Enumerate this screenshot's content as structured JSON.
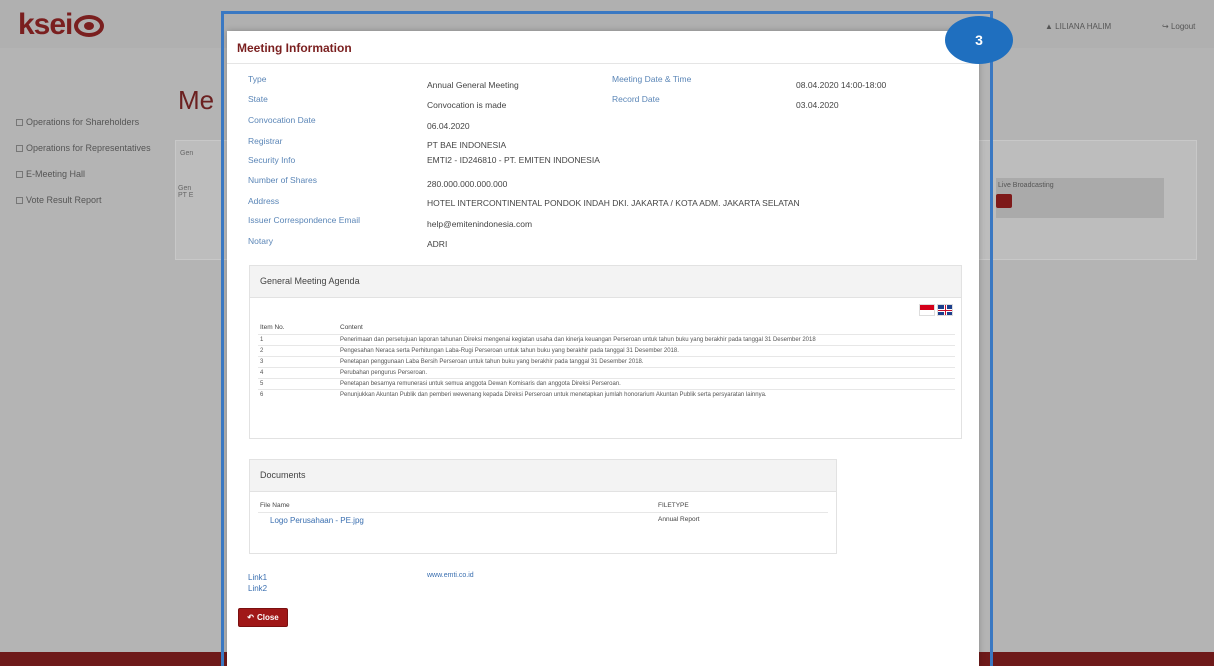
{
  "header": {
    "logo_text": "ksei",
    "logo_sub": "",
    "user_name": "LILIANA HALIM",
    "logout_label": "Logout"
  },
  "background": {
    "page_title": "Me",
    "tab_label": "Gen",
    "gen_label": "Gen",
    "gen_sub": "PT E",
    "live_label": "Live Broadcasting"
  },
  "sidebar": {
    "items": [
      {
        "label": "Operations for Shareholders"
      },
      {
        "label": "Operations for Representatives"
      },
      {
        "label": "E-Meeting Hall"
      },
      {
        "label": "Vote Result Report"
      }
    ]
  },
  "step_badge": "3",
  "modal": {
    "title": "Meeting Information",
    "fields": {
      "type_label": "Type",
      "type_value": "Annual General Meeting",
      "state_label": "State",
      "state_value": "Convocation is made",
      "convocation_label": "Convocation Date",
      "convocation_value": "06.04.2020",
      "registrar_label": "Registrar",
      "registrar_value": "PT BAE INDONESIA",
      "security_label": "Security Info",
      "security_value": "EMTI2 - ID246810 - PT. EMITEN INDONESIA",
      "shares_label": "Number of Shares",
      "shares_value": "280.000.000.000.000",
      "address_label": "Address",
      "address_value": "HOTEL INTERCONTINENTAL PONDOK INDAH DKI. JAKARTA / KOTA ADM. JAKARTA SELATAN",
      "email_label": "Issuer Correspondence Email",
      "email_value": "help@emitenindonesia.com",
      "notary_label": "Notary",
      "notary_value": "ADRI",
      "meeting_dt_label": "Meeting Date & Time",
      "meeting_dt_value": "08.04.2020 14:00-18:00",
      "record_label": "Record Date",
      "record_value": "03.04.2020"
    },
    "agenda": {
      "title": "General Meeting Agenda",
      "col_no": "Item No.",
      "col_content": "Content",
      "rows": [
        {
          "no": "1",
          "content": "Penerimaan dan persetujuan laporan tahunan Direksi mengenai kegiatan usaha dan kinerja keuangan Perseroan untuk tahun buku yang berakhir pada tanggal 31 Desember 2018"
        },
        {
          "no": "2",
          "content": "Pengesahan Neraca serta Perhitungan Laba-Rugi Perseroan untuk tahun buku yang berakhir pada tanggal 31 Desember 2018."
        },
        {
          "no": "3",
          "content": "Penetapan penggunaan Laba Bersih Perseroan untuk tahun buku yang berakhir pada tanggal 31 Desember 2018."
        },
        {
          "no": "4",
          "content": "Perubahan pengurus Perseroan."
        },
        {
          "no": "5",
          "content": "Penetapan besarnya remunerasi untuk semua anggota Dewan Komisaris dan anggota Direksi Perseroan."
        },
        {
          "no": "6",
          "content": "Penunjukkan Akuntan Publik dan pemberi wewenang kepada Direksi Perseroan untuk menetapkan jumlah honorarium Akuntan Publik serta persyaratan lainnya."
        }
      ]
    },
    "documents": {
      "title": "Documents",
      "col_file": "File Name",
      "col_type": "FILETYPE",
      "rows": [
        {
          "file": "Logo Perusahaan - PE.jpg",
          "type": "Annual Report"
        }
      ]
    },
    "links": {
      "link1_label": "Link1",
      "link2_label": "Link2",
      "link1_url": "www.emti.co.id"
    },
    "close_label": "Close"
  }
}
